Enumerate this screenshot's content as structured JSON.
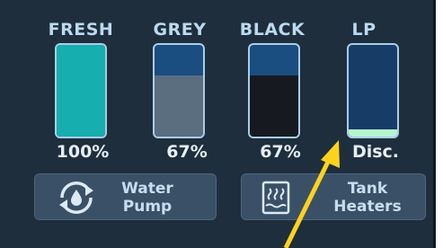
{
  "tanks": [
    {
      "label": "FRESH",
      "value": "100%",
      "level": 1.0,
      "fill_color": "#16aeae",
      "empty_color": "#173c66"
    },
    {
      "label": "GREY",
      "value": "67%",
      "level": 0.67,
      "fill_color": "#5a6e80",
      "empty_color": "#1a4d80"
    },
    {
      "label": "BLACK",
      "value": "67%",
      "level": 0.67,
      "fill_color": "#161a20",
      "empty_color": "#1a4d80"
    },
    {
      "label": "LP",
      "value": "Disc.",
      "level": 0.08,
      "fill_color": "#b6f5cf",
      "empty_color": "#173c66"
    }
  ],
  "buttons": {
    "water_pump": {
      "line1": "Water",
      "line2": "Pump",
      "icon": "water-pump-icon"
    },
    "tank_heaters": {
      "line1": "Tank",
      "line2": "Heaters",
      "icon": "tank-heater-icon"
    }
  },
  "colors": {
    "panel_bg": "#1e2e3c",
    "label_color": "#bcd9ef",
    "button_bg": "#3a5066",
    "annotation_arrow": "#ffd21e"
  }
}
